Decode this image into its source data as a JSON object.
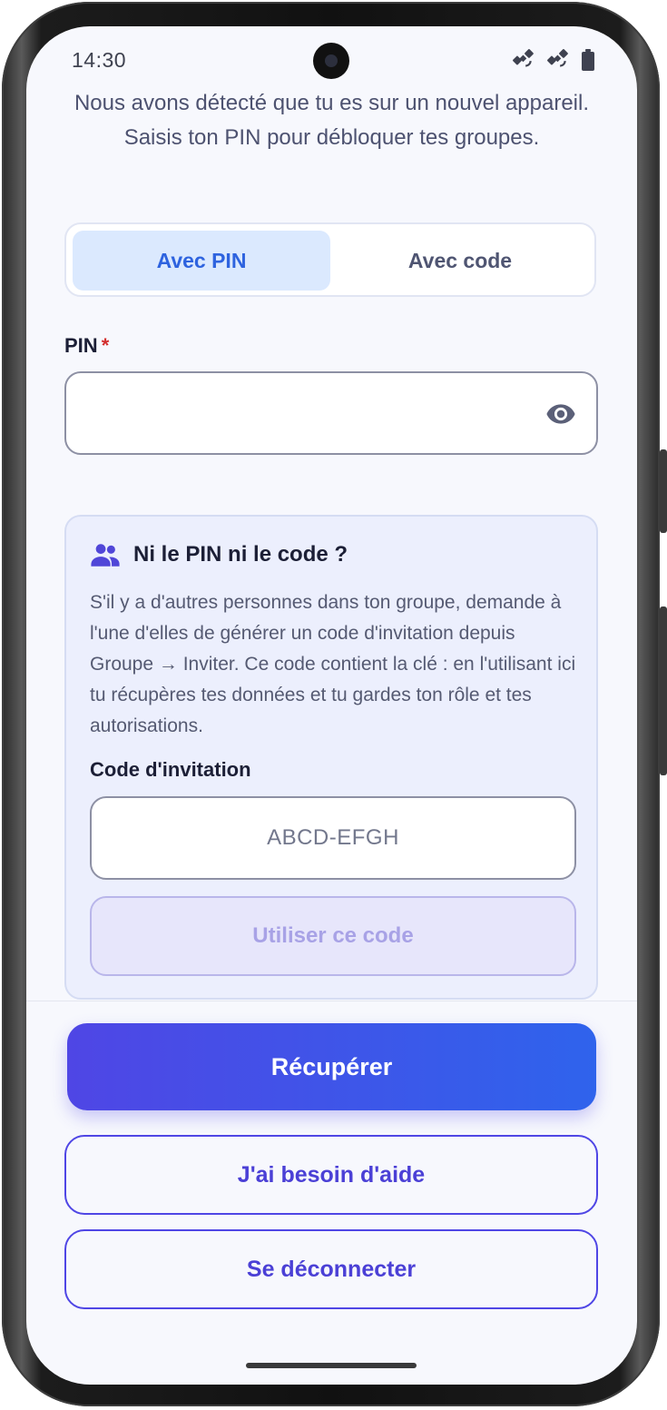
{
  "status_bar": {
    "time": "14:30",
    "icons": [
      "satellite-icon",
      "satellite-icon",
      "battery-icon"
    ]
  },
  "intro": {
    "text": "Nous avons détecté que tu es sur un nouvel appareil. Saisis ton PIN pour débloquer tes groupes."
  },
  "method_tabs": {
    "selected": "Avec PIN",
    "options": [
      {
        "label": "Avec PIN"
      },
      {
        "label": "Avec code"
      }
    ]
  },
  "pin_field": {
    "label": "PIN",
    "required_marker": "*",
    "value": "",
    "icon": "eye-icon"
  },
  "help_card": {
    "icon": "group-icon",
    "title": "Ni le PIN ni le code ?",
    "body": "S'il y a d'autres personnes dans ton groupe, demande à l'une d'elles de générer un code d'invitation depuis Groupe → Inviter. Ce code contient la clé : en l'utilisant ici tu récupères tes données et tu gardes ton rôle et tes autorisations.",
    "invite_label": "Code d'invitation",
    "invite_placeholder": "ABCD-EFGH",
    "invite_value": "",
    "use_code_label": "Utiliser ce code"
  },
  "actions": {
    "primary_label": "Récupérer",
    "help_label": "J'ai besoin d'aide",
    "logout_label": "Se déconnecter"
  },
  "colors": {
    "accent": "#4f46e5",
    "accent_end": "#2f63ec",
    "tab_selected_bg": "#dbe9fe",
    "tab_selected_text": "#2e63df",
    "required": "#d32f2f",
    "screen_bg": "#f7f8fd",
    "card_bg": "#eceffd"
  }
}
